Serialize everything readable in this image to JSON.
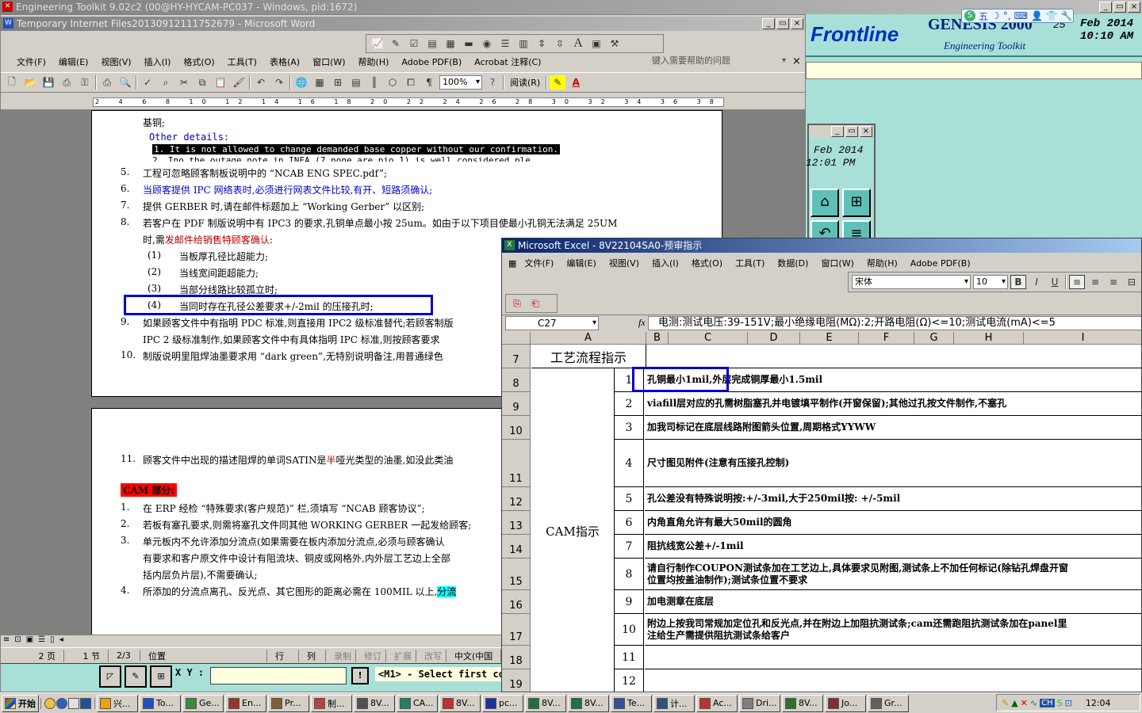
{
  "toolkit": {
    "title": "Engineering Toolkit 9.02c2 (00@HY-HYCAM-PC037 - Windows, pid:1672)"
  },
  "genesis": {
    "brand": "Frontline",
    "product": "GENESIS 2000",
    "subtitle": "Engineering Toolkit",
    "date": "Feb 2014",
    "time": "10:10 AM",
    "date_prefix": "25",
    "sub_date": "Feb 2014",
    "sub_time": "12:01 PM",
    "prompt_label": "X Y :",
    "prompt_msg": "<M1> - Select first co"
  },
  "word": {
    "title": "Temporary Internet Files20130912111752679 - Microsoft Word",
    "menu": [
      "文件(F)",
      "编辑(E)",
      "视图(V)",
      "插入(I)",
      "格式(O)",
      "工具(T)",
      "表格(A)",
      "窗口(W)",
      "帮助(H)",
      "Adobe PDF(B)",
      "Acrobat 注释(C)"
    ],
    "help_placeholder": "键入需要帮助的问题",
    "zoom": "100%",
    "read_label": "阅读(R)",
    "page1": {
      "l0": "基铜;",
      "other_details": "Other details:",
      "l_hl": "1. It is not allowed to change demanded base copper without our confirmation.",
      "l_cut": "2. Ino the outage note in INFA (7 none are pio 1) is well considered  ple",
      "items": [
        {
          "n": "5.",
          "t": "工程可忽略顾客制板说明中的 “NCAB ENG SPEC.pdf”;"
        },
        {
          "n": "6.",
          "t": "当顾客提供 IPC 网络表时,必须进行网表文件比较,有开、短路须确认;"
        },
        {
          "n": "7.",
          "t": "提供 GERBER 时,请在邮件标题加上 “Working Gerber” 以区别;"
        },
        {
          "n": "8.",
          "t": "若客户在 PDF 制版说明中有 IPC3 的要求,孔铜单点最小按 25um。如由于以下项目使最小孔铜无法满足 25UM"
        }
      ],
      "l8b_pre": "时,需",
      "l8b_blue": "发邮件给销售特顾客确认",
      "l8b_post": ":",
      "subs": [
        {
          "n": "(1)",
          "t": "当板厚孔径比超能力;"
        },
        {
          "n": "(2)",
          "t": "当线宽间距超能力;"
        },
        {
          "n": "(3)",
          "t": "当部分线路比较孤立时;"
        },
        {
          "n": "(4)",
          "t": "当同时存在孔径公差要求+/-2mil 的压接孔时;"
        }
      ],
      "l9": {
        "n": "9.",
        "t": "如果顾客文件中有指明 PDC 标准,则直接用 IPC2 级标准替代;若顾客制版"
      },
      "l9b": "IPC 2 级标准制作,如果顾客文件中有具体指明 IPC 标准,则按顾客要求",
      "l10": {
        "n": "10.",
        "t": "制版说明里阻焊油墨要求用 “dark green”,无特别说明备注,用普通绿色"
      }
    },
    "page2": {
      "l11": {
        "n": "11.",
        "pre": "顾客文件中出现的描述阻焊的单词SATIN是",
        "red": "半",
        "post": "哑光类型的油墨,如没此类油"
      },
      "cam_heading": "CAM 部分:",
      "items": [
        {
          "n": "1.",
          "t": "在 ERP 经检 “特殊要求(客户规范)” 栏,须填写 “NCAB 顾客协议”;"
        },
        {
          "n": "2.",
          "t": "若板有塞孔要求,则需将塞孔文件同其他 WORKING GERBER 一起发给顾客;"
        },
        {
          "n": "3.",
          "t": "单元板内不允许添加分流点(如果需要在板内添加分流点,必须与顾客确认"
        }
      ],
      "l3b": "有要求和客户原文件中设计有阻流块、铜皮或网格外,内外层工艺边上全部",
      "l3c": "括内层负片层),不需要确认;",
      "l4": {
        "n": "4.",
        "t": "所添加的分流点离孔、反光点、其它图形的距离必需在 100MIL 以上,",
        "hl": "分流"
      }
    },
    "status": [
      "2 页",
      "1 节",
      "2/3",
      "位置",
      "行",
      "列",
      "录制",
      "修订",
      "扩展",
      "改写",
      "中文(中国"
    ]
  },
  "excel": {
    "title": "Microsoft Excel - 8V22104SA0-预审指示",
    "menu": [
      "文件(F)",
      "编辑(E)",
      "视图(V)",
      "插入(I)",
      "格式(O)",
      "工具(T)",
      "数据(D)",
      "窗口(W)",
      "帮助(H)",
      "Adobe PDF(B)"
    ],
    "font": "宋体",
    "font_size": "10",
    "name_box": "C27",
    "fx": "fx",
    "formula": "电测:测试电压:39-151V;最小绝缘电阻(MΩ):2;开路电阻(Ω)<=10;测试电流(mA)<=5",
    "columns": [
      "A",
      "B",
      "C",
      "D",
      "E",
      "F",
      "G",
      "H",
      "I"
    ],
    "row7_label": "工艺流程指示",
    "merged_label": "CAM指示",
    "rows": [
      {
        "r": "7"
      },
      {
        "r": "8",
        "n": "1",
        "t": "孔铜最小1mil,外层完成铜厚最小1.5mil"
      },
      {
        "r": "9",
        "n": "2",
        "t": "viafill层对应的孔需树脂塞孔并电镀填平制作(开窗保留);其他过孔按文件制作,不塞孔"
      },
      {
        "r": "10",
        "n": "3",
        "t": "加我司标记在底层线路附图箭头位置,周期格式YYWW"
      },
      {
        "r": "11",
        "n": "4",
        "t": "尺寸图见附件(注意有压接孔控制)"
      },
      {
        "r": "12",
        "n": "5",
        "t": "孔公差没有特殊说明按:+/-3mil,大于250mil按: +/-5mil"
      },
      {
        "r": "13",
        "n": "6",
        "t": "内角直角允许有最大50mil的圆角"
      },
      {
        "r": "14",
        "n": "7",
        "t": "阻抗线宽公差+/-1mil"
      },
      {
        "r": "15",
        "n": "8",
        "t": "请自行制作COUPON测试条加在工艺边上,具体要求见附图,测试条上不加任何标记(除钻孔焊盘开窗",
        "t2": "位置均按盖油制作);测试条位置不要求"
      },
      {
        "r": "16",
        "n": "9",
        "t": "加电测章在底层"
      },
      {
        "r": "17",
        "n": "10",
        "t": "附边上按我司常规加定位孔和反光点,并在附边上加阻抗测试条;cam还需跑阻抗测试条加在panel里",
        "t2": "注给生产需提供阻抗测试条给客户"
      },
      {
        "r": "18",
        "n": "11",
        "t": ""
      },
      {
        "r": "19",
        "n": "12",
        "t": ""
      }
    ]
  },
  "taskbar": {
    "start": "开始",
    "items": [
      "兴...",
      "To...",
      "Ge...",
      "En...",
      "Pr...",
      "制...",
      "8V...",
      "CA...",
      "8V...",
      "pc...",
      "8V...",
      "8V...",
      "Te...",
      "计...",
      "Ac...",
      "Dri...",
      "8V...",
      "Jo...",
      "Gr..."
    ],
    "clock": "12:04",
    "ime": "CH"
  },
  "ime_bar": "五",
  "colors": {
    "highlight_box": "#0000cc",
    "titlebar": "#0a246a",
    "genesis_bg": "#a8e0d8"
  }
}
